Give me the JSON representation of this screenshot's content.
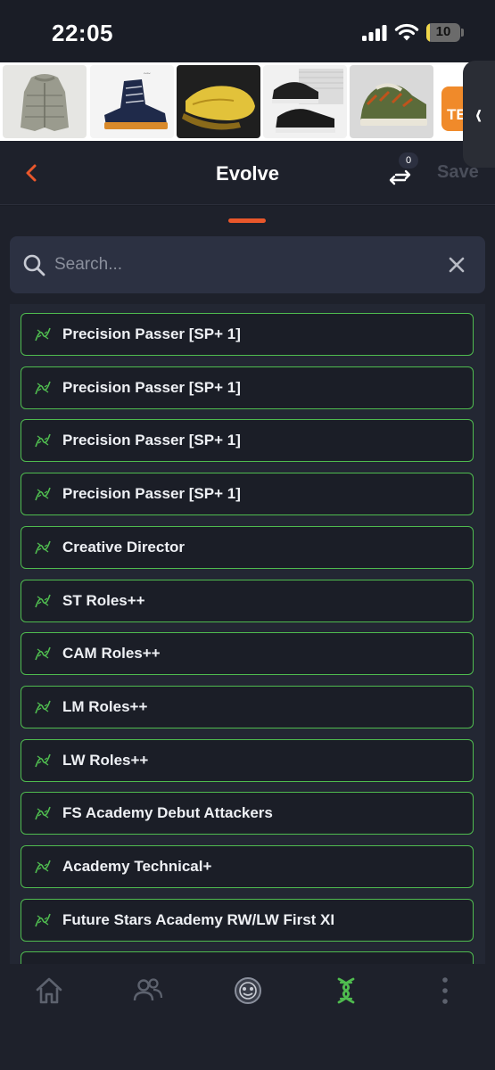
{
  "status_bar": {
    "time": "22:05",
    "battery_level": "10",
    "battery_fraction": 0.1
  },
  "ad_banner": {
    "tiles": [
      {
        "name": "puffer-jacket-ad",
        "bg": "#e6e6e3"
      },
      {
        "name": "navy-boot-ad",
        "bg": "#f4f4f4"
      },
      {
        "name": "yellow-loafer-ad",
        "bg": "#1f1f1f"
      },
      {
        "name": "black-sneaker-ad",
        "bg": "#f1f1f1"
      },
      {
        "name": "patterned-sneaker-ad",
        "bg": "#d9d9d9"
      }
    ],
    "partial_text": "TE"
  },
  "header": {
    "title": "Evolve",
    "compare_count": "0",
    "save_label": "Save"
  },
  "search": {
    "placeholder": "Search...",
    "value": ""
  },
  "evolutions": [
    {
      "label": "Precision  Passer [SP+ 1]"
    },
    {
      "label": "Precision  Passer [SP+ 1]"
    },
    {
      "label": "Precision  Passer [SP+ 1]"
    },
    {
      "label": "Precision  Passer [SP+ 1]"
    },
    {
      "label": "Creative Director"
    },
    {
      "label": "ST Roles++"
    },
    {
      "label": "CAM Roles++"
    },
    {
      "label": "LM Roles++"
    },
    {
      "label": "LW Roles++"
    },
    {
      "label": "FS Academy Debut Attackers"
    },
    {
      "label": "Academy Technical+"
    },
    {
      "label": "Future Stars Academy RW/LW First XI"
    },
    {
      "label": ""
    }
  ],
  "bottom_nav": {
    "items": [
      {
        "name": "nav-home",
        "icon": "home-icon",
        "active": false
      },
      {
        "name": "nav-squad",
        "icon": "users-icon",
        "active": false
      },
      {
        "name": "nav-club",
        "icon": "club-badge-icon",
        "active": false
      },
      {
        "name": "nav-evolve",
        "icon": "dna-icon",
        "active": true
      },
      {
        "name": "nav-more",
        "icon": "more-vertical-icon",
        "active": false
      }
    ]
  },
  "colors": {
    "accent": "#e9572b",
    "evolution_border": "#4fbb4f",
    "background": "#1a1d26",
    "panel": "#1e212b"
  }
}
